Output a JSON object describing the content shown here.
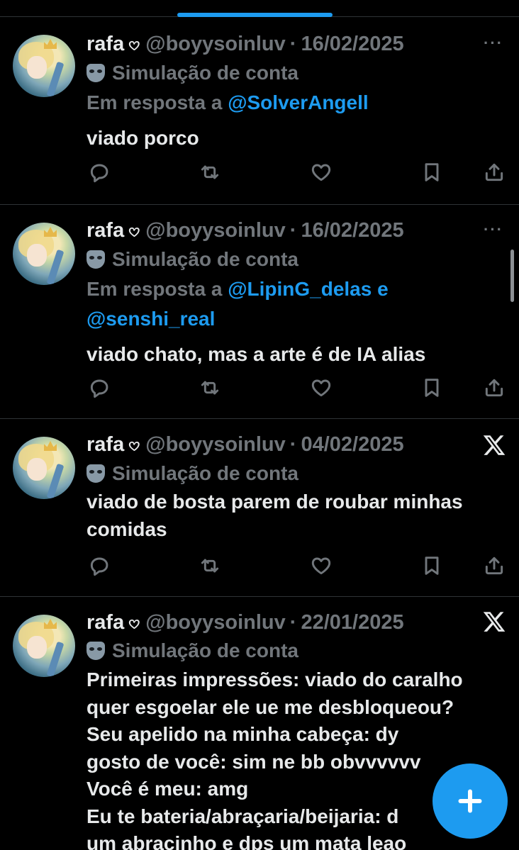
{
  "tweets": [
    {
      "name": "rafa",
      "name_emoji": "𖹭",
      "handle": "@boyysoinluv",
      "separator": "·",
      "date": "16/02/2025",
      "simulation_label": "Simulação de conta",
      "reply_prefix": "Em resposta a",
      "reply_mentions": [
        "@SolverAngell"
      ],
      "text": "viado porco",
      "corner": "more"
    },
    {
      "name": "rafa",
      "name_emoji": "𖹭",
      "handle": "@boyysoinluv",
      "separator": "·",
      "date": "16/02/2025",
      "simulation_label": "Simulação de conta",
      "reply_prefix": "Em resposta a",
      "reply_mentions": [
        "@LipinG_delas",
        "@senshi_real"
      ],
      "reply_join": "e",
      "text": "viado chato, mas a arte é de IA alias",
      "corner": "more"
    },
    {
      "name": "rafa",
      "name_emoji": "𖹭",
      "handle": "@boyysoinluv",
      "separator": "·",
      "date": "04/02/2025",
      "simulation_label": "Simulação de conta",
      "text": "viado de bosta parem de roubar minhas\ncomidas",
      "corner": "x-logo"
    },
    {
      "name": "rafa",
      "name_emoji": "𖹭",
      "handle": "@boyysoinluv",
      "separator": "·",
      "date": "22/01/2025",
      "simulation_label": "Simulação de conta",
      "text": "Primeiras impressões: viado do caralho\nquer esgoelar ele ue me desbloqueou?\nSeu apelido na minha cabeça: dy\ngosto de você: sim ne bb obvvvvvv\nVocê é meu: amg\nEu te bateria/abraçaria/beijaria: d\num abracinho e dps um mata leao",
      "corner": "x-logo"
    }
  ],
  "more_glyph": "···",
  "icons": {
    "reply": "reply-icon",
    "retweet": "retweet-icon",
    "like": "like-icon",
    "bookmark": "bookmark-icon",
    "share": "share-icon",
    "compose": "plus-icon"
  },
  "colors": {
    "accent": "#1d9bf0",
    "muted": "#71767b",
    "text": "#e7e9ea",
    "background": "#000000"
  }
}
